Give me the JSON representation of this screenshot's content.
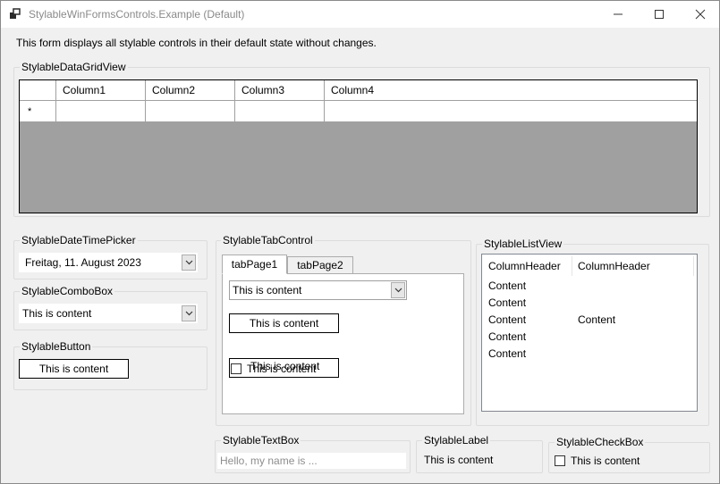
{
  "window": {
    "title": "StylableWinFormsControls.Example (Default)",
    "controls": {
      "minimize": "minimize-icon",
      "maximize": "maximize-icon",
      "close": "close-icon"
    }
  },
  "intro": "This form displays all stylable controls in their default state without changes.",
  "datagrid": {
    "group_label": "StylableDataGridView",
    "columns": [
      "Column1",
      "Column2",
      "Column3",
      "Column4"
    ],
    "new_row_marker": "*"
  },
  "datetimepicker": {
    "group_label": "StylableDateTimePicker",
    "value": "Freitag, 11. August 2023"
  },
  "combobox": {
    "group_label": "StylableComboBox",
    "value": "This is content"
  },
  "button": {
    "group_label": "StylableButton",
    "label": "This is content"
  },
  "tabcontrol": {
    "group_label": "StylableTabControl",
    "tabs": [
      "tabPage1",
      "tabPage2"
    ],
    "combo_value": "This is content",
    "button_label": "This is content",
    "checkbox_label": "This is content",
    "overlap_label": "This is content"
  },
  "listview": {
    "group_label": "StylableListView",
    "headers": [
      "ColumnHeader",
      "ColumnHeader"
    ],
    "col1": [
      "Content",
      "Content",
      "Content",
      "Content",
      "Content"
    ],
    "col2_item": "Content"
  },
  "textbox": {
    "group_label": "StylableTextBox",
    "placeholder": "Hello, my name is ..."
  },
  "label": {
    "group_label": "StylableLabel",
    "text": "This is content"
  },
  "checkbox": {
    "group_label": "StylableCheckBox",
    "label": "This is content"
  },
  "colors": {
    "grid_background": "#a0a0a0",
    "window_background": "#f0f0f0"
  }
}
